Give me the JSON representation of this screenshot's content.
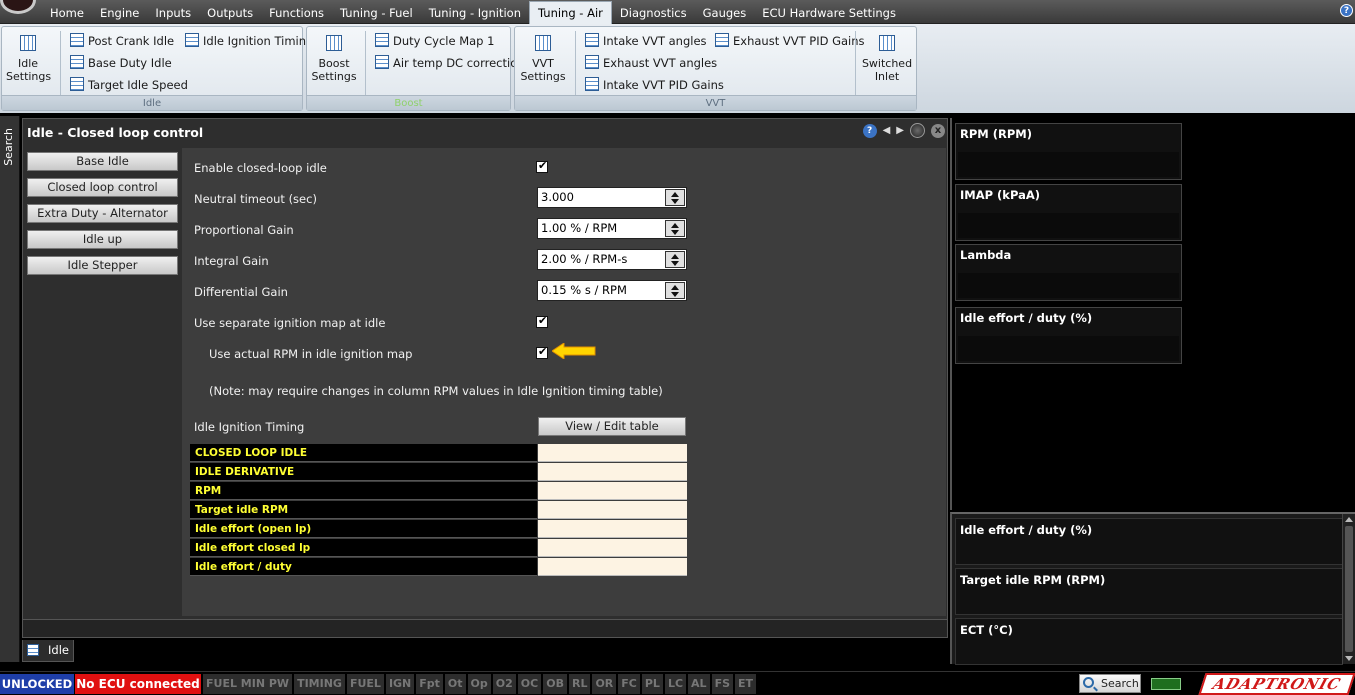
{
  "menu": {
    "tabs": [
      "Home",
      "Engine",
      "Inputs",
      "Outputs",
      "Functions",
      "Tuning - Fuel",
      "Tuning - Ignition",
      "Tuning - Air",
      "Diagnostics",
      "Gauges",
      "ECU Hardware Settings"
    ],
    "active": "Tuning - Air",
    "help": "?"
  },
  "ribbon": {
    "idle": {
      "label": "Idle",
      "big": "Idle Settings",
      "items": [
        "Post Crank Idle",
        "Base Duty Idle",
        "Target Idle Speed",
        "Idle Ignition Timing"
      ]
    },
    "boost": {
      "label": "Boost",
      "big": "Boost Settings",
      "items": [
        "Duty Cycle Map 1",
        "Air temp DC correction"
      ]
    },
    "vvt": {
      "label": "VVT",
      "big": "VVT Settings",
      "items": [
        "Intake VVT angles",
        "Exhaust VVT angles",
        "Intake VVT PID Gains",
        "Exhaust VVT PID Gains"
      ],
      "big2": "Switched Inlet"
    }
  },
  "search_strip": "Search",
  "panel": {
    "title": "Idle - Closed loop control",
    "help": "?",
    "close": "x",
    "sub_buttons": [
      "Base Idle",
      "Closed loop control",
      "Extra Duty - Alternator",
      "Idle up",
      "Idle Stepper"
    ],
    "fields": {
      "enable": "Enable closed-loop idle",
      "neutral_timeout_label": "Neutral timeout (sec)",
      "neutral_timeout_value": "3.000",
      "p_gain_label": "Proportional Gain",
      "p_gain_value": "1.00 % / RPM",
      "i_gain_label": "Integral Gain",
      "i_gain_value": "2.00 % / RPM-s",
      "d_gain_label": "Differential Gain",
      "d_gain_value": "0.15 % s / RPM",
      "sep_ign": "Use separate ignition map at idle",
      "actual_rpm": "Use actual RPM in idle ignition map",
      "note": "(Note: may require changes in column RPM values in Idle Ignition timing table)",
      "idle_ign_timing": "Idle Ignition Timing",
      "view_edit": "View / Edit table"
    },
    "table_rows": [
      "CLOSED LOOP IDLE",
      "IDLE DERIVATIVE",
      "RPM",
      "Target idle RPM",
      "Idle effort (open lp)",
      "Idle effort closed lp",
      "Idle effort / duty"
    ]
  },
  "bottom_tab": "Idle",
  "gauges_top": [
    "RPM (RPM)",
    "IMAP  (kPaA)",
    "Lambda",
    "Idle effort / duty (%)"
  ],
  "gauges_bottom": [
    "Idle effort / duty (%)",
    "Target idle RPM (RPM)",
    "ECT (°C)"
  ],
  "status": {
    "unlocked": "UNLOCKED",
    "ecu": "No ECU connected",
    "flags": [
      "FUEL MIN PW",
      "TIMING",
      "FUEL",
      "IGN",
      "Fpt",
      "Ot",
      "Op",
      "O2",
      "OC",
      "OB",
      "RL",
      "OR",
      "FC",
      "PL",
      "LC",
      "AL",
      "FS",
      "ET"
    ],
    "search": "Search",
    "logo": "ADAPTRONIC"
  },
  "colors": {
    "accent_yellow": "#ffff33",
    "status_red": "#e01010",
    "status_blue": "#1e3ea8",
    "ribbon_bg": "#dfe6ec"
  }
}
